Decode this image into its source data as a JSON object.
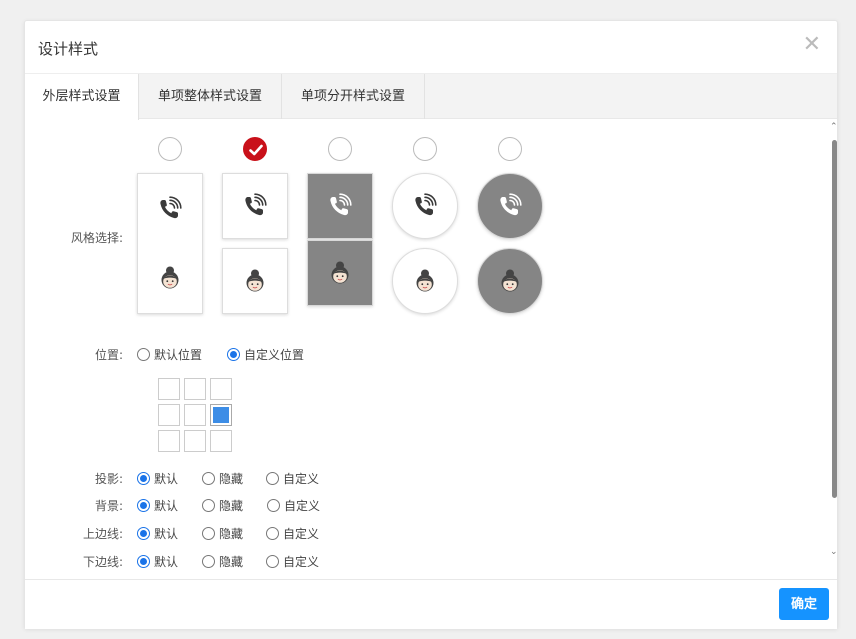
{
  "dialog": {
    "title": "设计样式",
    "close_symbol": "✕"
  },
  "tabs": [
    {
      "label": "外层样式设置",
      "active": true
    },
    {
      "label": "单项整体样式设置",
      "active": false
    },
    {
      "label": "单项分开样式设置",
      "active": false
    }
  ],
  "style_select": {
    "label": "风格选择:",
    "selected_index": 1,
    "option_count": 5
  },
  "position": {
    "label": "位置:",
    "options": [
      {
        "label": "默认位置",
        "checked": false
      },
      {
        "label": "自定义位置",
        "checked": true
      }
    ],
    "grid_selected": {
      "row": 2,
      "col": 3
    }
  },
  "settings": [
    {
      "label": "投影:",
      "options": [
        "默认",
        "隐藏",
        "自定义"
      ],
      "selected": 0
    },
    {
      "label": "背景:",
      "options": [
        "默认",
        "隐藏",
        "自定义"
      ],
      "selected": 0
    },
    {
      "label": "上边线:",
      "options": [
        "默认",
        "隐藏",
        "自定义"
      ],
      "selected": 0
    },
    {
      "label": "下边线:",
      "options": [
        "默认",
        "隐藏",
        "自定义"
      ],
      "selected": 0
    }
  ],
  "footer": {
    "ok_label": "确定"
  },
  "colors": {
    "accent": "#1593ff",
    "selected_red": "#c9111a",
    "radio_blue": "#1a73e8",
    "dark_card": "#858585"
  }
}
